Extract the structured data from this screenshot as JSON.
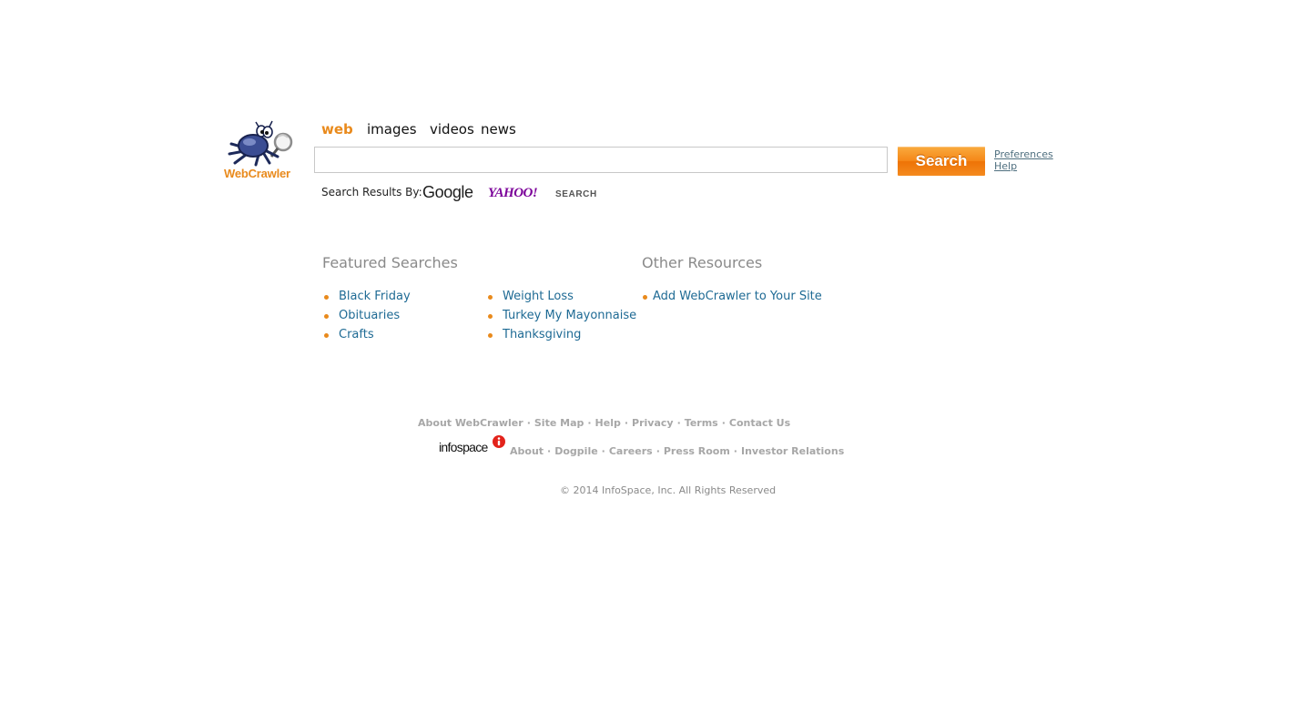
{
  "logo": {
    "text": "WebCrawler"
  },
  "tabs": [
    {
      "label": "web",
      "active": true
    },
    {
      "label": "images",
      "active": false
    },
    {
      "label": "videos",
      "active": false
    },
    {
      "label": "news",
      "active": false
    }
  ],
  "search": {
    "value": "",
    "placeholder": "",
    "button_label": "Search"
  },
  "side_links": {
    "preferences": "Preferences",
    "help": "Help"
  },
  "results_by": {
    "label": "Search Results By:",
    "google": "Google",
    "yahoo": "YAHOO!",
    "yahoo_search": "SEARCH"
  },
  "featured": {
    "title": "Featured Searches",
    "col1": [
      "Black Friday",
      "Obituaries",
      "Crafts"
    ],
    "col2": [
      "Weight Loss",
      "Turkey My Mayonnaise",
      "Thanksgiving"
    ]
  },
  "other": {
    "title": "Other Resources",
    "items": [
      "Add WebCrawler to Your Site"
    ]
  },
  "footer": {
    "row1": [
      "About WebCrawler",
      "Site Map",
      "Help",
      "Privacy",
      "Terms",
      "Contact Us"
    ],
    "infospace": "infospace",
    "row2": [
      "About",
      "Dogpile",
      "Careers",
      "Press Room",
      "Investor Relations"
    ],
    "copyright": "© 2014 InfoSpace, Inc. All Rights Reserved"
  },
  "colors": {
    "accent": "#e98a1c",
    "link": "#1e6a94",
    "muted": "#8a8a8a"
  },
  "icons": {
    "logo": "spider-mascot-icon",
    "infospace": "infospace-logo-icon"
  }
}
